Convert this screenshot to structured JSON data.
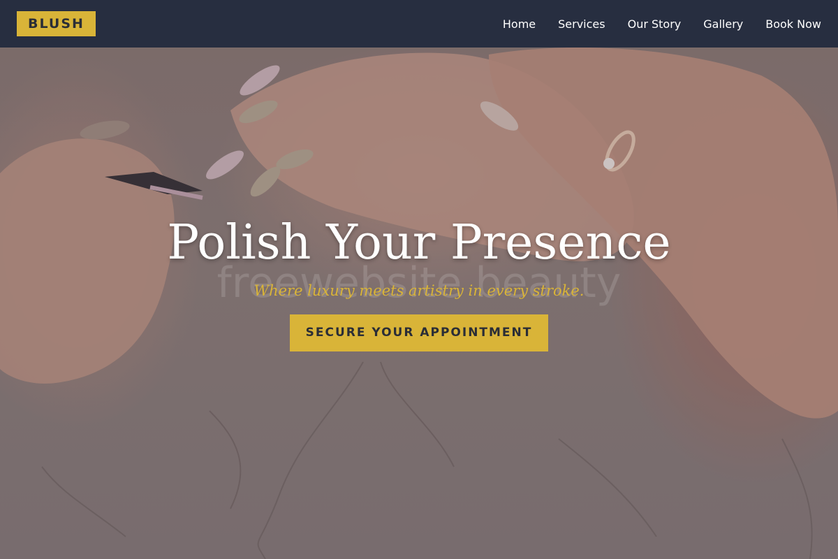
{
  "header": {
    "logo": "BLUSH",
    "nav": [
      "Home",
      "Services",
      "Our Story",
      "Gallery",
      "Book Now"
    ]
  },
  "hero": {
    "headline": "Polish Your Presence",
    "tagline": "Where luxury meets artistry in every stroke.",
    "cta": "SECURE YOUR APPOINTMENT",
    "watermark": "freewebsite beauty"
  },
  "colors": {
    "header_bg": "#272e40",
    "accent": "#d9b438",
    "headline": "#ffffff"
  }
}
